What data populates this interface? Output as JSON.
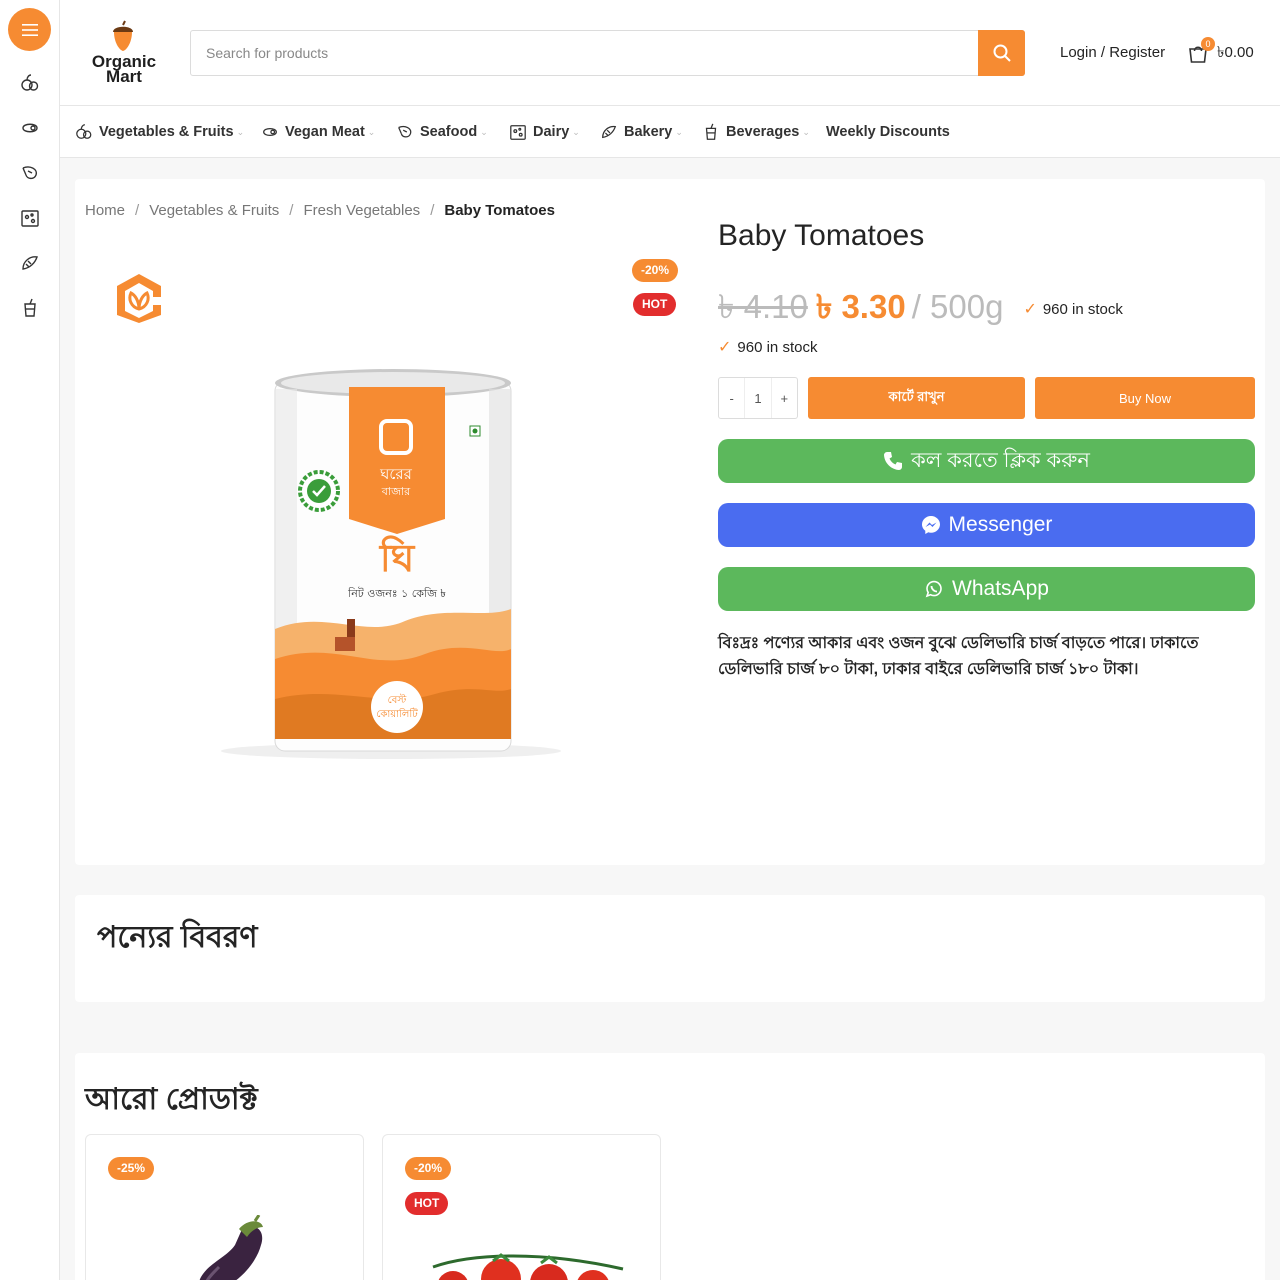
{
  "colors": {
    "accent": "#f68b32",
    "hot": "#e22d2d",
    "call_green": "#5cb85c",
    "messenger_blue": "#4a6cf0"
  },
  "rail": {
    "toggle_icon": "hamburger-icon",
    "icons": [
      "vegetables-icon",
      "vegan-meat-icon",
      "seafood-icon",
      "dairy-icon",
      "bakery-icon",
      "beverages-icon"
    ]
  },
  "header": {
    "logo": {
      "line1": "Organic",
      "line2": "Mart"
    },
    "search": {
      "placeholder": "Search for products",
      "icon": "search-icon"
    },
    "login_label": "Login / Register",
    "cart": {
      "count": "0",
      "total": "৳0.00",
      "icon": "cart-icon"
    }
  },
  "nav": {
    "items": [
      {
        "label": "Vegetables & Fruits",
        "icon": "vegetables-icon"
      },
      {
        "label": "Vegan Meat",
        "icon": "vegan-meat-icon"
      },
      {
        "label": "Seafood",
        "icon": "seafood-icon"
      },
      {
        "label": "Dairy",
        "icon": "dairy-icon"
      },
      {
        "label": "Bakery",
        "icon": "bakery-icon"
      },
      {
        "label": "Beverages",
        "icon": "beverages-icon"
      },
      {
        "label": "Weekly Discounts"
      }
    ]
  },
  "breadcrumb": [
    "Home",
    "Vegetables & Fruits",
    "Fresh Vegetables",
    "Baby Tomatoes"
  ],
  "product": {
    "title": "Baby Tomatoes",
    "old_price": "৳ 4.10",
    "price": "৳ 3.30",
    "unit": "/ 500g",
    "stock_inline": "960 in stock",
    "stock": "960 in stock",
    "badges": {
      "sale": "-20%",
      "hot": "HOT"
    },
    "can_label": {
      "brand_line1": "ঘরের",
      "brand_line2": "বাজার",
      "name": "ঘি",
      "weight": "নিট ওজনঃ ১ কেজি ৳",
      "quality_line1": "বেস্ট",
      "quality_line2": "কোয়ালিটি"
    },
    "qty": {
      "minus": "-",
      "value": "1",
      "plus": "+"
    },
    "add_to_cart": "কার্টে রাখুন",
    "buy_now": "Buy Now",
    "call": "কল করতে ক্লিক করুন",
    "messenger": "Messenger",
    "whatsapp": "WhatsApp",
    "note": "বিঃদ্রঃ পণ্যের আকার এবং ওজন বুঝে ডেলিভারি চার্জ বাড়তে পারে। ঢাকাতে ডেলিভারি চার্জ ৮০ টাকা, ঢাকার বাইরে ডেলিভারি চার্জ ১৮০ টাকা।"
  },
  "description": {
    "title": "পন্যের বিবরণ"
  },
  "more_products": {
    "title": "আরো প্রোডাক্ট",
    "items": [
      {
        "sale": "-25%",
        "image": "eggplant-image"
      },
      {
        "sale": "-20%",
        "hot": "HOT",
        "image": "tomato-image"
      }
    ]
  }
}
